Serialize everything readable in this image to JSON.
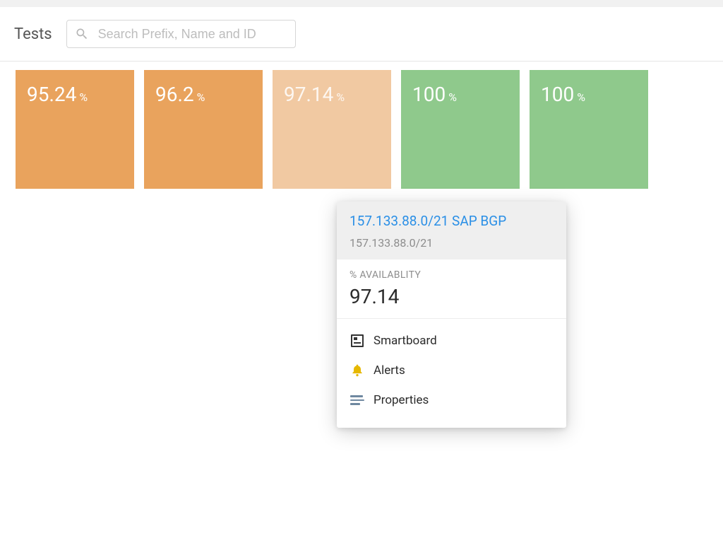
{
  "header": {
    "title": "Tests",
    "search_placeholder": "Search Prefix, Name and ID"
  },
  "tiles": [
    {
      "value": "95.24",
      "unit": "%",
      "color": "#e9a35d"
    },
    {
      "value": "96.2",
      "unit": "%",
      "color": "#e9a35d"
    },
    {
      "value": "97.14",
      "unit": "%",
      "color": "#f1c9a2"
    },
    {
      "value": "100",
      "unit": "%",
      "color": "#8fc98c"
    },
    {
      "value": "100",
      "unit": "%",
      "color": "#8fc98c"
    }
  ],
  "popover": {
    "title": "157.133.88.0/21 SAP BGP",
    "subtitle": "157.133.88.0/21",
    "metric_label": "% AVAILABLITY",
    "metric_value": "97.14",
    "actions": {
      "smartboard": "Smartboard",
      "alerts": "Alerts",
      "properties": "Properties"
    }
  }
}
